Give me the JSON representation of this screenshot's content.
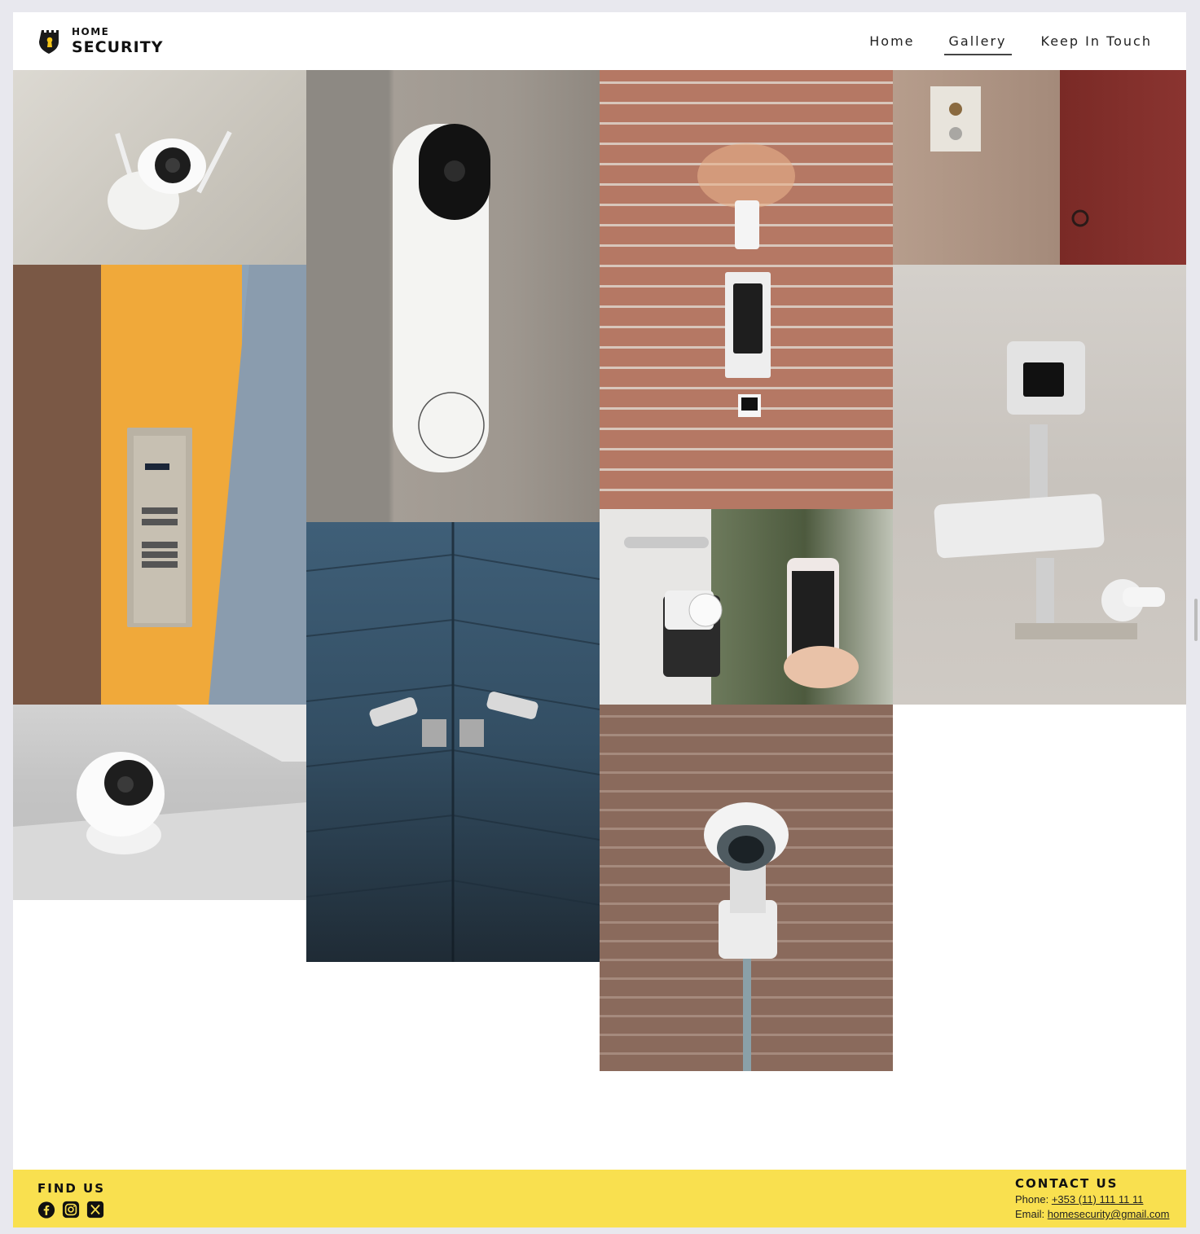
{
  "header": {
    "logo_top": "HOME",
    "logo_bottom": "SECURITY",
    "nav": [
      {
        "label": "Home"
      },
      {
        "label": "Gallery",
        "active": true
      },
      {
        "label": "Keep In Touch"
      }
    ]
  },
  "gallery": {
    "images": [
      {
        "name": "wifi-camera-photo"
      },
      {
        "name": "video-doorbell-photo"
      },
      {
        "name": "keypad-intercom-photo"
      },
      {
        "name": "door-intercom-photo"
      },
      {
        "name": "apartment-intercom-photo"
      },
      {
        "name": "cctv-cameras-photo"
      },
      {
        "name": "corner-cameras-photo"
      },
      {
        "name": "smart-lock-phone-photo"
      },
      {
        "name": "indoor-camera-photo"
      },
      {
        "name": "dome-camera-photo"
      }
    ]
  },
  "footer": {
    "find_us_title": "FIND US",
    "socials": [
      "facebook-icon",
      "instagram-icon",
      "x-icon"
    ],
    "contact_title": "CONTACT US",
    "phone_label": "Phone: ",
    "phone_value": "+353 (11) 111 11 11",
    "email_label": "Email: ",
    "email_value": "homesecurity@gmail.com"
  },
  "colors": {
    "footer_bg": "#f9e04f",
    "page_bg": "#ffffff",
    "outer_bg": "#e8e8ee"
  }
}
